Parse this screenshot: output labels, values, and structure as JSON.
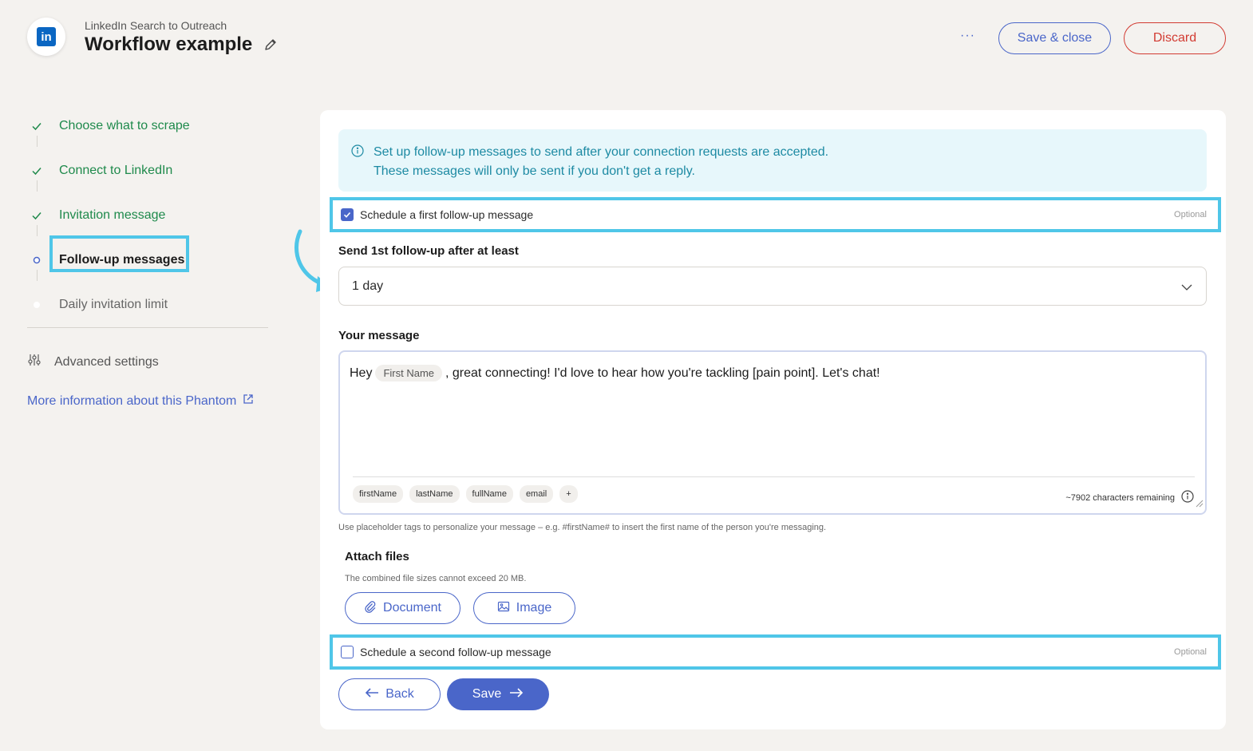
{
  "header": {
    "subtitle": "LinkedIn Search to Outreach",
    "title": "Workflow example",
    "more_label": "···",
    "save_close_label": "Save & close",
    "discard_label": "Discard",
    "logo_text": "in"
  },
  "sidebar": {
    "steps": [
      {
        "label": "Choose what to scrape",
        "status": "done"
      },
      {
        "label": "Connect to LinkedIn",
        "status": "done"
      },
      {
        "label": "Invitation message",
        "status": "done"
      },
      {
        "label": "Follow-up messages",
        "status": "current"
      },
      {
        "label": "Daily invitation limit",
        "status": "upcoming"
      }
    ],
    "advanced_label": "Advanced settings",
    "more_info_label": "More information about this Phantom"
  },
  "main": {
    "info_line1": "Set up follow-up messages to send after your connection requests are accepted.",
    "info_line2": "These messages will only be sent if you don't get a reply.",
    "first_followup": {
      "label": "Schedule a first follow-up message",
      "optional": "Optional",
      "checked": true
    },
    "delay_label": "Send 1st follow-up after at least",
    "delay_value": "1 day",
    "message_label": "Your message",
    "message": {
      "prefix": "Hey",
      "tag": "First Name",
      "suffix": ", great connecting! I'd love to hear how you're tackling [pain point]. Let's chat!"
    },
    "chips": [
      "firstName",
      "lastName",
      "fullName",
      "email",
      "+"
    ],
    "remaining": "~7902 characters remaining",
    "help": "Use placeholder tags to personalize your message – e.g. #firstName# to insert the first name of the person you're messaging.",
    "attach_title": "Attach files",
    "attach_help": "The combined file sizes cannot exceed 20 MB.",
    "document_label": "Document",
    "image_label": "Image",
    "second_followup": {
      "label": "Schedule a second follow-up message",
      "optional": "Optional",
      "checked": false
    },
    "back_label": "Back",
    "save_label": "Save"
  },
  "colors": {
    "accent": "#4a66c9",
    "success": "#1f8a4c",
    "danger": "#d23b32",
    "highlight": "#4fc6e8",
    "info_bg": "#e7f7fb"
  }
}
